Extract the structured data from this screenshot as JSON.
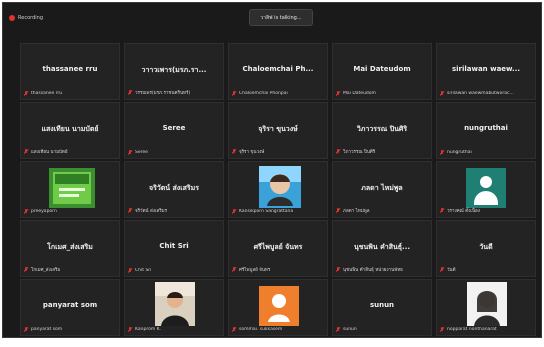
{
  "top": {
    "recording_label": "Recording",
    "talking_label": "วาสิฟ is talking..."
  },
  "tiles": [
    {
      "name": "thassanee rru",
      "label": "thassanee rru"
    },
    {
      "name": "วาาวเพาร(มรภ.รา...",
      "label": "วรรณพร(มรภ.ราชนครินทร์)"
    },
    {
      "name": "Chaloemchai Ph...",
      "label": "Chaloemchai Phonpai"
    },
    {
      "name": "Mai Dateudom",
      "label": "Mai Dateudom"
    },
    {
      "name": "sirilawan waew...",
      "label": "sirilawan waewmabutworac..."
    },
    {
      "name": "แสงเทียน นามบัตย์",
      "label": "แสงเทียน นามบัตย์"
    },
    {
      "name": "Seree",
      "label": "Seree"
    },
    {
      "name": "จุริรา ขุนวงษ์",
      "label": "จุริรา ขุนวงษ์"
    },
    {
      "name": "วิภาวรรณ ปินศิริ",
      "label": "วิภาวรรณ ปินศิริ"
    },
    {
      "name": "nungruthai",
      "label": "nungruthai"
    },
    {
      "name": "",
      "label": "preeyaporn"
    },
    {
      "name": "จริวัตน์ ส่งเสริมร",
      "label": "จริวัตน์ ส่งเสริมร"
    },
    {
      "name": "",
      "label": "Kansikporn Sangrattana"
    },
    {
      "name": "ภลดา ไหม่พูล",
      "label": "ภลดา ไหม่พูล"
    },
    {
      "name": "",
      "label": "วรางคณ์ ตั้งเนื่อง"
    },
    {
      "name": "โกเมศ_ส่งเสริม",
      "label": "โกเมศ_ส่งเสริม"
    },
    {
      "name": "Chit Sri",
      "label": "Chit Sri"
    },
    {
      "name": "ศรีไพบูลย์ จันทร",
      "label": "ศรีไพบูลย์ จันทร"
    },
    {
      "name": "นุชนพิน คำสินธุ์...",
      "label": "นุชนพิน คำสินธุ์ หน่วยงานพัทธ"
    },
    {
      "name": "วันดี",
      "label": "วันดี"
    },
    {
      "name": "panyarat som",
      "label": "panyarat som"
    },
    {
      "name": "",
      "label": "Kanprom K."
    },
    {
      "name": "",
      "label": "sommai. sukkasem"
    },
    {
      "name": "sunun",
      "label": "sunun"
    },
    {
      "name": "",
      "label": "nopparat nonthanarat"
    }
  ]
}
